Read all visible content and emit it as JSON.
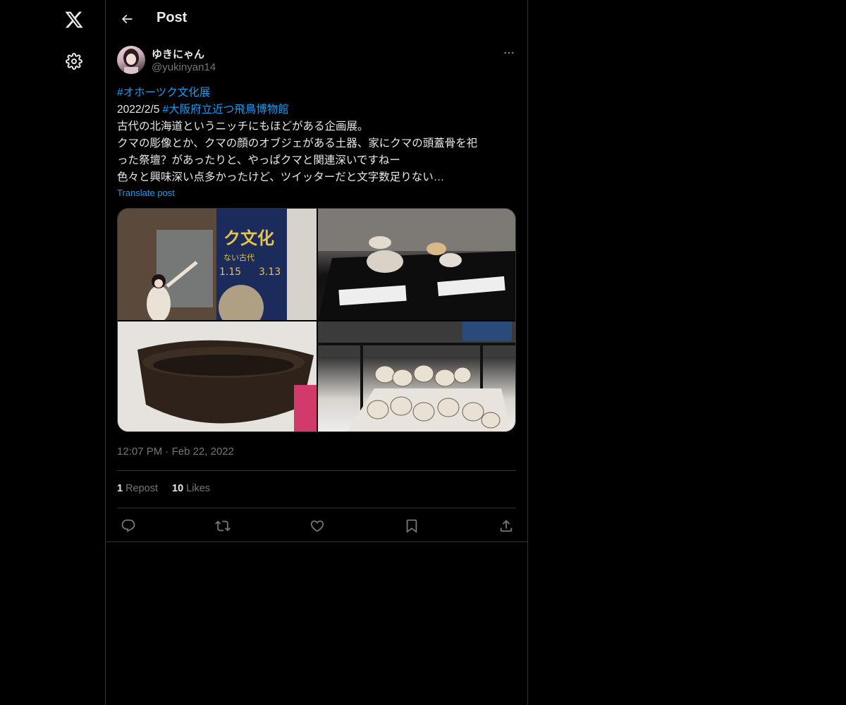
{
  "nav": {
    "logo_icon": "x-logo-icon",
    "settings_icon": "gear-icon"
  },
  "header": {
    "title": "Post",
    "back_icon": "arrow-left-icon"
  },
  "author": {
    "display_name": "ゆきにゃん",
    "handle": "@yukinyan14"
  },
  "tweet": {
    "hashtag1": "#オホーツク文化展",
    "date": "2022/2/5 ",
    "hashtag2": "#大阪府立近つ飛鳥博物館",
    "line3": "古代の北海道というニッチにもほどがある企画展。",
    "line4": "クマの彫像とか、クマの顔のオブジェがある土器、家にクマの頭蓋骨を祀",
    "line5": "った祭壇？があったりと、やっぱクマと関連深いですねー",
    "line6": "色々と興味深い点多かったけど、ツイッターだと文字数足りない…",
    "translate": "Translate post"
  },
  "media": {
    "photo1": {
      "poster_text1": "ク文化",
      "poster_text2": "ない古代",
      "date_start": "1.15",
      "date_end": "3.13"
    },
    "photo2": {},
    "photo3": {},
    "photo4": {}
  },
  "meta": {
    "time": "12:07 PM",
    "sep": " · ",
    "date": "Feb 22, 2022"
  },
  "stats": {
    "reposts_count": "1",
    "reposts_label": "Repost",
    "likes_count": "10",
    "likes_label": "Likes"
  },
  "colors": {
    "accent": "#1d9bf0",
    "background": "#000000",
    "text": "#e7e9ea",
    "muted": "#71767b",
    "border": "#2f3336"
  }
}
